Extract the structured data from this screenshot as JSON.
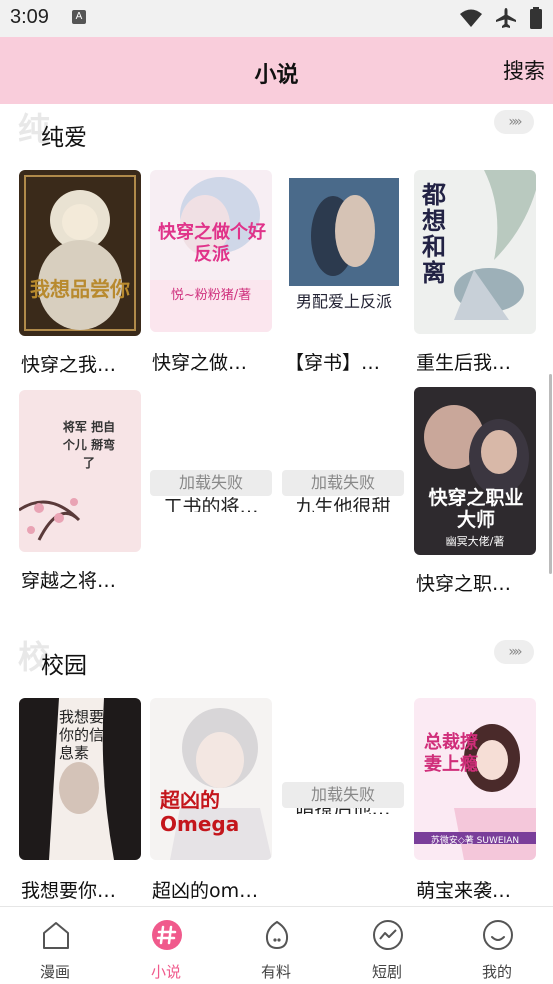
{
  "status": {
    "time": "3:09",
    "a_badge": "A"
  },
  "header": {
    "title": "小说",
    "search_label": "搜索"
  },
  "sections": [
    {
      "ghost": "纯",
      "title": "纯爱",
      "more": "»»",
      "books": [
        {
          "title": "快穿之我…",
          "cover_text": "我想品尝你"
        },
        {
          "title": "快穿之做…",
          "cover_text": "快穿之做个好反派",
          "cover_sub": "悦~粉粉猪/著"
        },
        {
          "title": "【穿书】…",
          "cover_text": "男配爱上反派"
        },
        {
          "title": "重生后我…",
          "cover_text": "都想和离"
        },
        {
          "title": "穿越之将…",
          "cover_text": "将军 把自个儿 掰弯了"
        },
        {
          "title": "",
          "fail": "加载失败",
          "under": "工书的将…"
        },
        {
          "title": "",
          "fail": "加载失败",
          "under": "九生他很甜"
        },
        {
          "title": "快穿之职…",
          "cover_text": "快穿之职业大师",
          "cover_sub": "幽冥大佬/著"
        }
      ]
    },
    {
      "ghost": "校",
      "title": "校园",
      "more": "»»",
      "books": [
        {
          "title": "我想要你…",
          "cover_text": "我想要你的信息素"
        },
        {
          "title": "超凶的om…",
          "cover_text": "超凶的Omega"
        },
        {
          "title": "",
          "fail": "加载失败",
          "under": "暗撩后他…"
        },
        {
          "title": "萌宝来袭…",
          "cover_text": "总裁撩妻上瘾",
          "cover_sub": "苏微安◇著 SUWEIAN"
        }
      ]
    }
  ],
  "tabs": [
    {
      "label": "漫画",
      "icon": "home-icon"
    },
    {
      "label": "小说",
      "icon": "hash-icon",
      "active": true
    },
    {
      "label": "有料",
      "icon": "egg-icon"
    },
    {
      "label": "短剧",
      "icon": "trend-icon"
    },
    {
      "label": "我的",
      "icon": "smile-icon"
    }
  ],
  "colors": {
    "header_bg": "#f9cddb",
    "accent": "#f05a8c"
  }
}
